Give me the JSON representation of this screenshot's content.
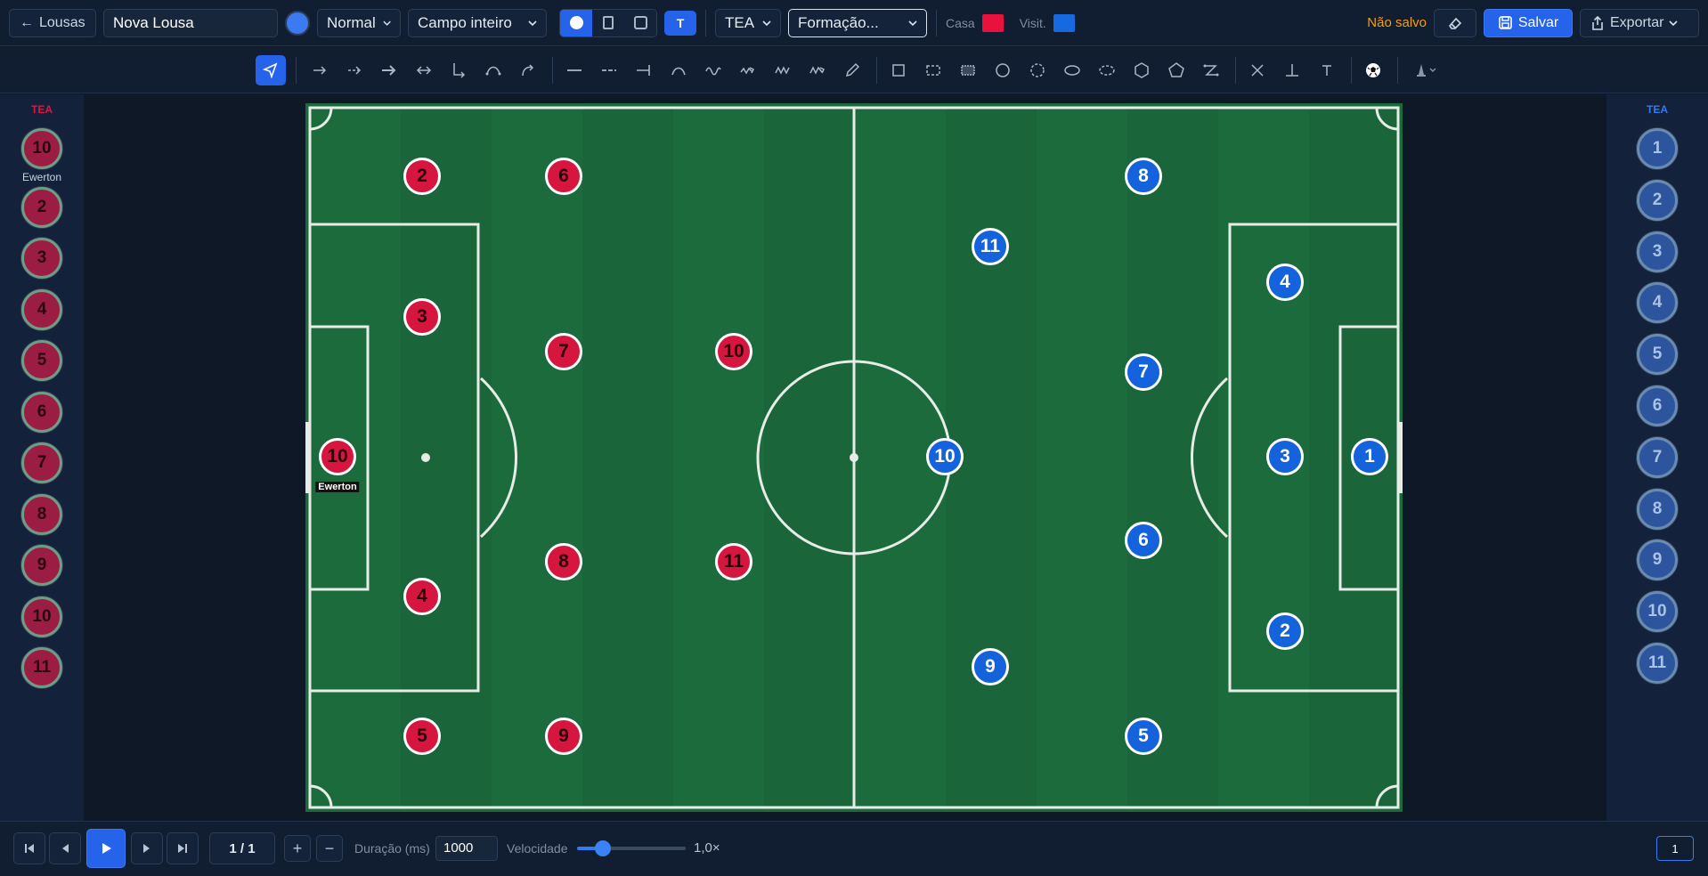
{
  "topbar": {
    "back_label": "Lousas",
    "board_name": "Nova Lousa",
    "mode_select": "Normal",
    "field_select": "Campo inteiro",
    "team_select": "TEA",
    "formation_select": "Formação...",
    "home_label": "Casa",
    "home_color": "#e8123c",
    "away_label": "Visit.",
    "away_color": "#1669e0",
    "unsaved_label": "Não salvo",
    "save_label": "Salvar",
    "export_label": "Exportar",
    "view_toggle_text": "T"
  },
  "left_sidebar": {
    "team": "TEA",
    "first_label": "Ewerton",
    "chips": [
      "10",
      "2",
      "3",
      "4",
      "5",
      "6",
      "7",
      "8",
      "9",
      "10",
      "11"
    ]
  },
  "right_sidebar": {
    "team": "TEA",
    "chips": [
      "1",
      "2",
      "3",
      "4",
      "5",
      "6",
      "7",
      "8",
      "9",
      "10",
      "11"
    ]
  },
  "pitch": {
    "home_players": [
      {
        "n": "2"
      },
      {
        "n": "6"
      },
      {
        "n": "3"
      },
      {
        "n": "7"
      },
      {
        "n": "10"
      },
      {
        "n": "10",
        "label": "Ewerton"
      },
      {
        "n": "8"
      },
      {
        "n": "11"
      },
      {
        "n": "4"
      },
      {
        "n": "5"
      },
      {
        "n": "9"
      }
    ],
    "away_players": [
      {
        "n": "8"
      },
      {
        "n": "11"
      },
      {
        "n": "4"
      },
      {
        "n": "7"
      },
      {
        "n": "10"
      },
      {
        "n": "3"
      },
      {
        "n": "1"
      },
      {
        "n": "6"
      },
      {
        "n": "2"
      },
      {
        "n": "9"
      },
      {
        "n": "5"
      }
    ]
  },
  "bottombar": {
    "frame": "1 / 1",
    "duration_label": "Duração (ms)",
    "duration_value": "1000",
    "speed_label": "Velocidade",
    "speed_value": "1,0×",
    "speed_fraction": 0.24,
    "page": "1"
  }
}
